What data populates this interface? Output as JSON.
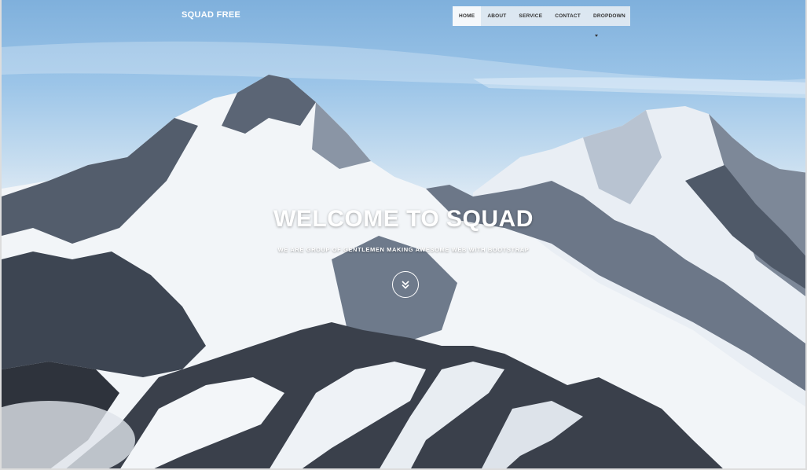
{
  "brand": "SQUAD FREE",
  "nav": {
    "items": [
      {
        "label": "HOME"
      },
      {
        "label": "ABOUT"
      },
      {
        "label": "SERVICE"
      },
      {
        "label": "CONTACT"
      },
      {
        "label": "DROPDOWN"
      }
    ]
  },
  "hero": {
    "title": "WELCOME TO SQUAD",
    "subtitle": "WE ARE GROUP OF GENTLEMEN MAKING AWESOME WEB WITH BOOTSTRAP",
    "scroll_icon": "double-chevron-down-icon"
  },
  "colors": {
    "sky_top": "#7fb0dc",
    "snow": "#f2f5f8",
    "rock": "#3f4652",
    "nav_bg": "#ebf0f5"
  }
}
